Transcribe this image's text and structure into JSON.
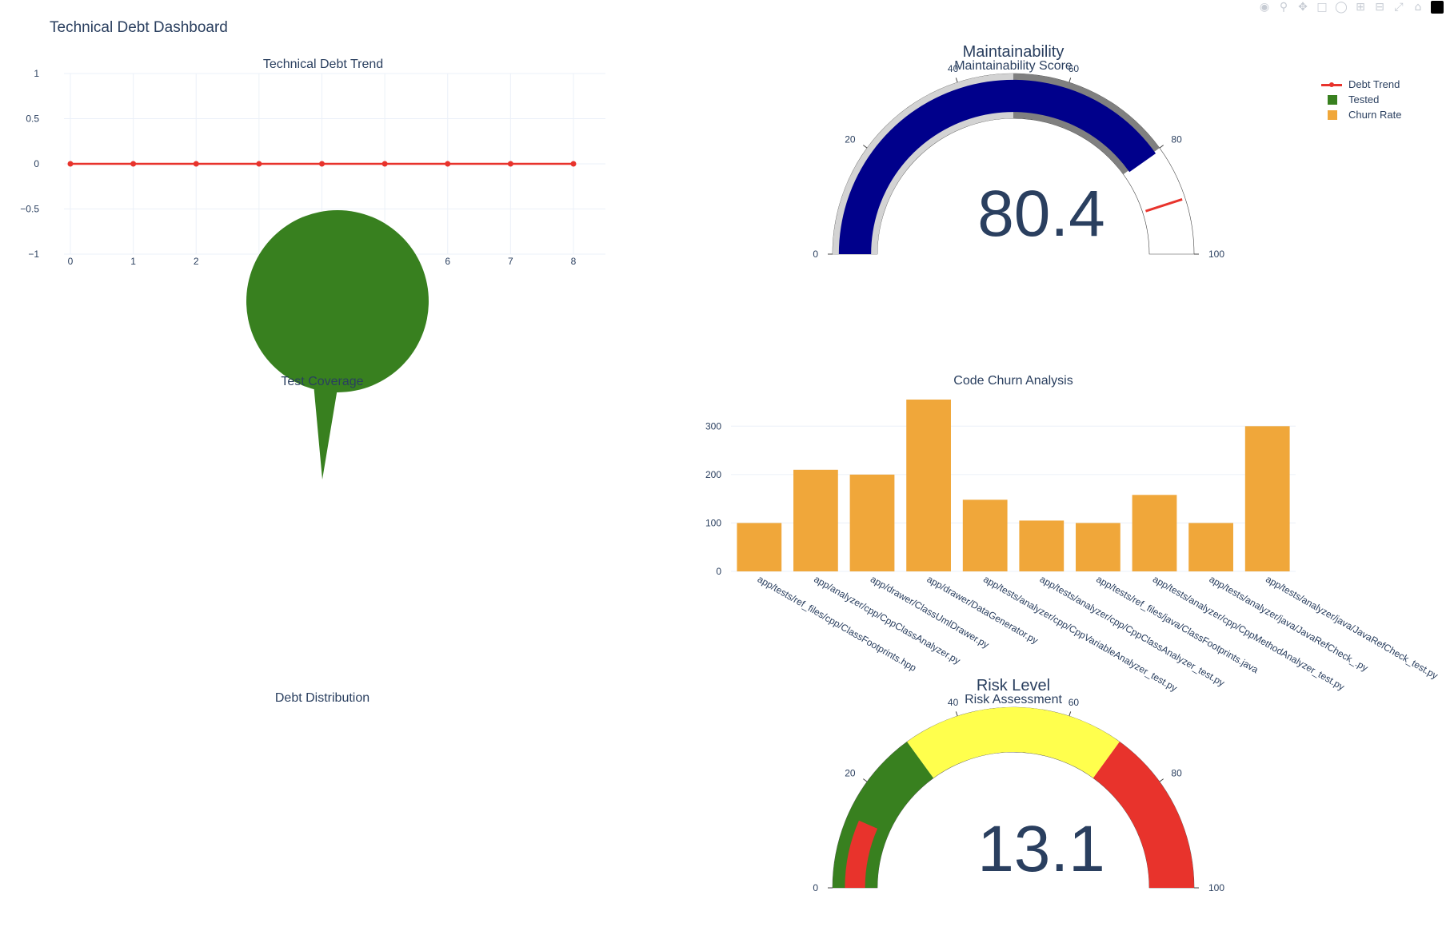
{
  "dashboard": {
    "title": "Technical Debt Dashboard"
  },
  "modebar": {
    "icons": [
      "camera-icon",
      "zoom-icon",
      "pan-icon",
      "box-select-icon",
      "lasso-icon",
      "zoom-in-icon",
      "zoom-out-icon",
      "autoscale-icon",
      "reset-axes-icon",
      "plotly-logo-icon"
    ]
  },
  "legend": {
    "items": [
      {
        "label": "Debt Trend",
        "color": "#e8332c",
        "kind": "line"
      },
      {
        "label": "Tested",
        "color": "#38801f",
        "kind": "box"
      },
      {
        "label": "Churn Rate",
        "color": "#f0a73a",
        "kind": "box"
      }
    ]
  },
  "colors": {
    "line": "#e8332c",
    "tested": "#38801f",
    "churn": "#f0a73a",
    "gauge_bar": "#00008b",
    "gauge_light": "#d3d3d3",
    "gauge_dark": "#808080",
    "risk_low": "#38801f",
    "risk_mid": "#ffff4d",
    "risk_high": "#e8332c",
    "grid": "#ebf0f8"
  },
  "chart_data": [
    {
      "id": "debt-trend",
      "type": "line",
      "title": "Technical Debt Trend",
      "x": [
        0,
        1,
        2,
        3,
        4,
        5,
        6,
        7,
        8
      ],
      "y": [
        0,
        0,
        0,
        0,
        0,
        0,
        0,
        0,
        0
      ],
      "series_name": "Debt Trend",
      "xlim": [
        0,
        8
      ],
      "ylim": [
        -1,
        1
      ],
      "xticks": [
        "0",
        "1",
        "2",
        "6",
        "7",
        "8"
      ],
      "yticks": [
        "1",
        "0.5",
        "0",
        "−0.5",
        "−1"
      ],
      "grid": true
    },
    {
      "id": "maintainability",
      "type": "gauge",
      "title": "Maintainability",
      "subtitle": "Maintainability Score",
      "value": 80.4,
      "value_text": "80.4",
      "range": [
        0,
        100
      ],
      "ticks": [
        "0",
        "20",
        "40",
        "60",
        "80",
        "100"
      ],
      "steps": [
        {
          "range": [
            0,
            50
          ],
          "color": "#d3d3d3"
        },
        {
          "range": [
            50,
            80
          ],
          "color": "#808080"
        }
      ],
      "threshold": 90
    },
    {
      "id": "test-coverage",
      "type": "pie",
      "title": "Test Coverage",
      "labels": [
        "Tested"
      ],
      "values": [
        100
      ]
    },
    {
      "id": "code-churn",
      "type": "bar",
      "title": "Code Churn Analysis",
      "series_name": "Churn Rate",
      "categories": [
        "app/tests/ref_files/cpp/ClassFootprints.hpp",
        "app/analyzer/cpp/CppClassAnalyzer.py",
        "app/drawer/ClassUmlDrawer.py",
        "app/drawer/DataGenerator.py",
        "app/tests/analyzer/cpp/CppVariableAnalyzer_test.py",
        "app/tests/analyzer/cpp/CppClassAnalyzer_test.py",
        "app/tests/ref_files/java/ClassFootprints.java",
        "app/tests/analyzer/cpp/CppMethodAnalyzer_test.py",
        "app/tests/analyzer/java/JavaRefCheck_.py",
        "app/tests/analyzer/java/JavaRefCheck_test.py"
      ],
      "values": [
        100,
        210,
        200,
        355,
        148,
        105,
        100,
        158,
        100,
        300
      ],
      "ylim": [
        0,
        355
      ],
      "yticks": [
        0,
        100,
        200,
        300
      ]
    },
    {
      "id": "debt-distribution",
      "type": "pie",
      "title": "Debt Distribution",
      "labels": [],
      "values": []
    },
    {
      "id": "risk-level",
      "type": "gauge",
      "title": "Risk Level",
      "subtitle": "Risk Assessment",
      "value": 13.1,
      "value_text": "13.1",
      "range": [
        0,
        100
      ],
      "ticks": [
        "0",
        "20",
        "40",
        "60",
        "80",
        "100"
      ],
      "steps": [
        {
          "range": [
            0,
            30
          ],
          "color": "#38801f"
        },
        {
          "range": [
            30,
            70
          ],
          "color": "#ffff4d"
        },
        {
          "range": [
            70,
            100
          ],
          "color": "#e8332c"
        }
      ]
    }
  ]
}
